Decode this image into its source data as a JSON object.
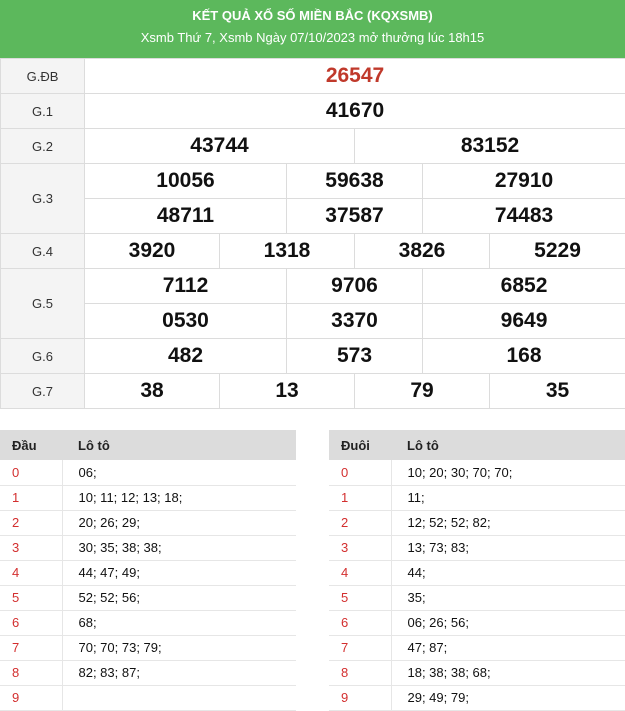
{
  "header": {
    "title": "KẾT QUẢ XỔ SỐ MIỀN BẮC (KQXSMB)",
    "subtitle": "Xsmb Thứ 7, Xsmb Ngày 07/10/2023 mở thưởng lúc 18h15"
  },
  "prizes": {
    "gdb": {
      "label": "G.ĐB",
      "numbers": [
        "26547"
      ]
    },
    "g1": {
      "label": "G.1",
      "numbers": [
        "41670"
      ]
    },
    "g2": {
      "label": "G.2",
      "numbers": [
        "43744",
        "83152"
      ]
    },
    "g3": {
      "label": "G.3",
      "numbers": [
        "10056",
        "59638",
        "27910",
        "48711",
        "37587",
        "74483"
      ]
    },
    "g4": {
      "label": "G.4",
      "numbers": [
        "3920",
        "1318",
        "3826",
        "5229"
      ]
    },
    "g5": {
      "label": "G.5",
      "numbers": [
        "7112",
        "9706",
        "6852",
        "0530",
        "3370",
        "9649"
      ]
    },
    "g6": {
      "label": "G.6",
      "numbers": [
        "482",
        "573",
        "168"
      ]
    },
    "g7": {
      "label": "G.7",
      "numbers": [
        "38",
        "13",
        "79",
        "35"
      ]
    }
  },
  "dau": {
    "col1": "Đầu",
    "col2": "Lô tô",
    "rows": [
      {
        "k": "0",
        "v": "06;"
      },
      {
        "k": "1",
        "v": "10; 11; 12; 13; 18;"
      },
      {
        "k": "2",
        "v": "20; 26; 29;"
      },
      {
        "k": "3",
        "v": "30; 35; 38; 38;"
      },
      {
        "k": "4",
        "v": "44; 47; 49;"
      },
      {
        "k": "5",
        "v": "52; 52; 56;"
      },
      {
        "k": "6",
        "v": "68;"
      },
      {
        "k": "7",
        "v": "70; 70; 73; 79;"
      },
      {
        "k": "8",
        "v": "82; 83; 87;"
      },
      {
        "k": "9",
        "v": ""
      }
    ]
  },
  "duoi": {
    "col1": "Đuôi",
    "col2": "Lô tô",
    "rows": [
      {
        "k": "0",
        "v": "10; 20; 30; 70; 70;"
      },
      {
        "k": "1",
        "v": "11;"
      },
      {
        "k": "2",
        "v": "12; 52; 52; 82;"
      },
      {
        "k": "3",
        "v": "13; 73; 83;"
      },
      {
        "k": "4",
        "v": "44;"
      },
      {
        "k": "5",
        "v": "35;"
      },
      {
        "k": "6",
        "v": "06; 26; 56;"
      },
      {
        "k": "7",
        "v": "47; 87;"
      },
      {
        "k": "8",
        "v": "18; 38; 38; 68;"
      },
      {
        "k": "9",
        "v": "29; 49; 79;"
      }
    ]
  },
  "colors": {
    "header_bg": "#5cb85c",
    "special": "#c0392b",
    "loto_head": "#d32f2f"
  }
}
